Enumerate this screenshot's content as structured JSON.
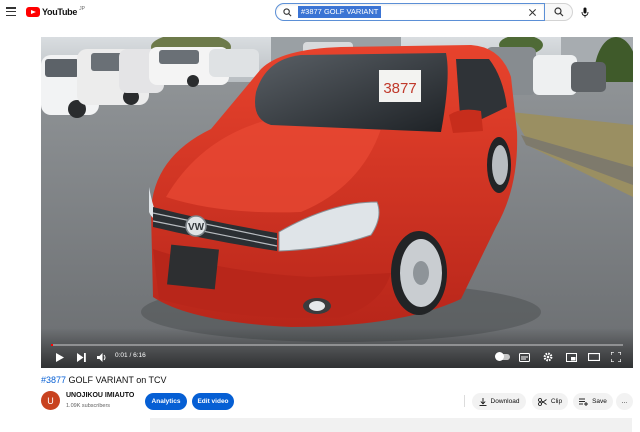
{
  "header": {
    "logo_text": "YouTube",
    "logo_superscript": "JP",
    "search": {
      "value": "#3877 GOLF VARIANT",
      "placeholder": "Search"
    },
    "icons": [
      "menu-icon",
      "search-icon",
      "clear-icon",
      "mic-icon"
    ]
  },
  "player": {
    "current_time": "0:01",
    "duration": "6:16",
    "time_display": "0:01 / 6:16",
    "progress_fraction": 0.003,
    "scene": {
      "price_card_text": "3877",
      "subject": "red Volkswagen Golf Variant wagon in a parking lot"
    },
    "controls_left": [
      "play-icon",
      "next-icon",
      "volume-icon"
    ],
    "controls_right": [
      "autoplay-toggle",
      "subtitles-icon",
      "settings-icon",
      "miniplayer-icon",
      "theater-icon",
      "fullscreen-icon"
    ]
  },
  "video": {
    "title_tag": "#3877",
    "title_rest": " GOLF VARIANT on TCV"
  },
  "channel": {
    "avatar_letter": "U",
    "name": "UNOJIKOU IMIAUTO",
    "subscribers": "1.09K subscribers",
    "avatar_color": "#c8421f"
  },
  "actions": {
    "analytics": "Analytics",
    "edit_video": "Edit video",
    "download": "Download",
    "clip": "Clip",
    "save": "Save",
    "more": "..."
  },
  "colors": {
    "accent_blue": "#065fd4",
    "youtube_red": "#ff0000",
    "car_red": "#d9321f"
  }
}
